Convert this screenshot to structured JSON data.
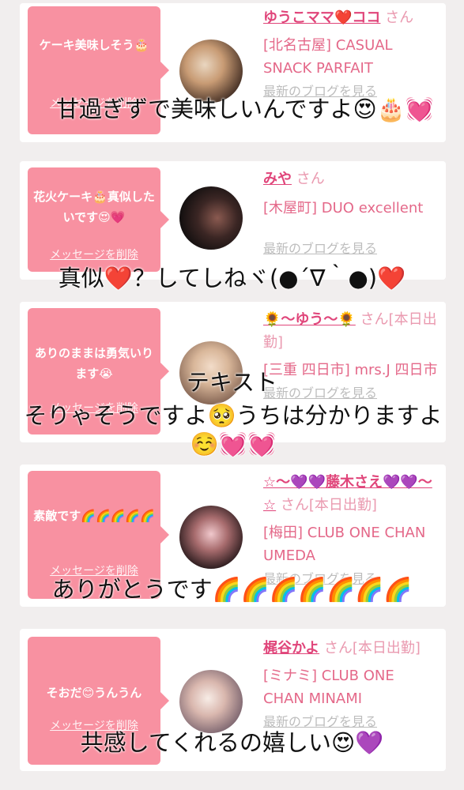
{
  "cards": [
    {
      "bubble_message": "ケーキ美味しそう🎂",
      "delete_label": "メッセージを削除",
      "user_name": "ゆうこママ❤️ココ",
      "honorific": "さん",
      "shop": "[北名古屋] CASUAL SNACK PARFAIT",
      "blog_link": "最新のブログを見る"
    },
    {
      "bubble_message": "花火ケーキ🎂真似したいです😍💗",
      "delete_label": "メッセージを削除",
      "user_name": "みや",
      "honorific": "さん",
      "shop": "[木屋町] DUO excellent",
      "blog_link": "最新のブログを見る"
    },
    {
      "bubble_message": "ありのままは勇気いります😭",
      "delete_label": "メッセージを削除",
      "user_name": "🌻〜ゆう〜🌻",
      "honorific": "さん[本日出勤]",
      "shop": "[三重 四日市] mrs.J 四日市",
      "blog_link": "最新のブログを見る"
    },
    {
      "bubble_message": "素敵です🌈🌈🌈🌈🌈",
      "delete_label": "メッセージを削除",
      "user_name": "☆〜💜💜藤木さえ💜💜〜☆",
      "honorific": "さん[本日出勤]",
      "shop": "[梅田] CLUB ONE CHAN UMEDA",
      "blog_link": "最新のブログを見る"
    },
    {
      "bubble_message": "そおだ😊うんうん",
      "delete_label": "メッセージを削除",
      "user_name": "梶谷かよ",
      "honorific": "さん[本日出勤]",
      "shop": "[ミナミ] CLUB ONE CHAN MINAMI",
      "blog_link": "最新のブログを見る"
    }
  ],
  "overlays": [
    "甘過ぎずで美味しいんですよ😍🎂💓",
    "真似❤️？してしねヾ(●´∇｀●)❤️",
    "テキスト",
    "そりゃそうですよ🥺うちは分かりますよ☺️💓💓",
    "ありがとうです🌈🌈🌈🌈🌈🌈🌈",
    "共感してくれるの嬉しい😍💜"
  ],
  "colors": {
    "bubble": "#f891a1",
    "name": "#e0457a",
    "background": "#f1eeee"
  }
}
